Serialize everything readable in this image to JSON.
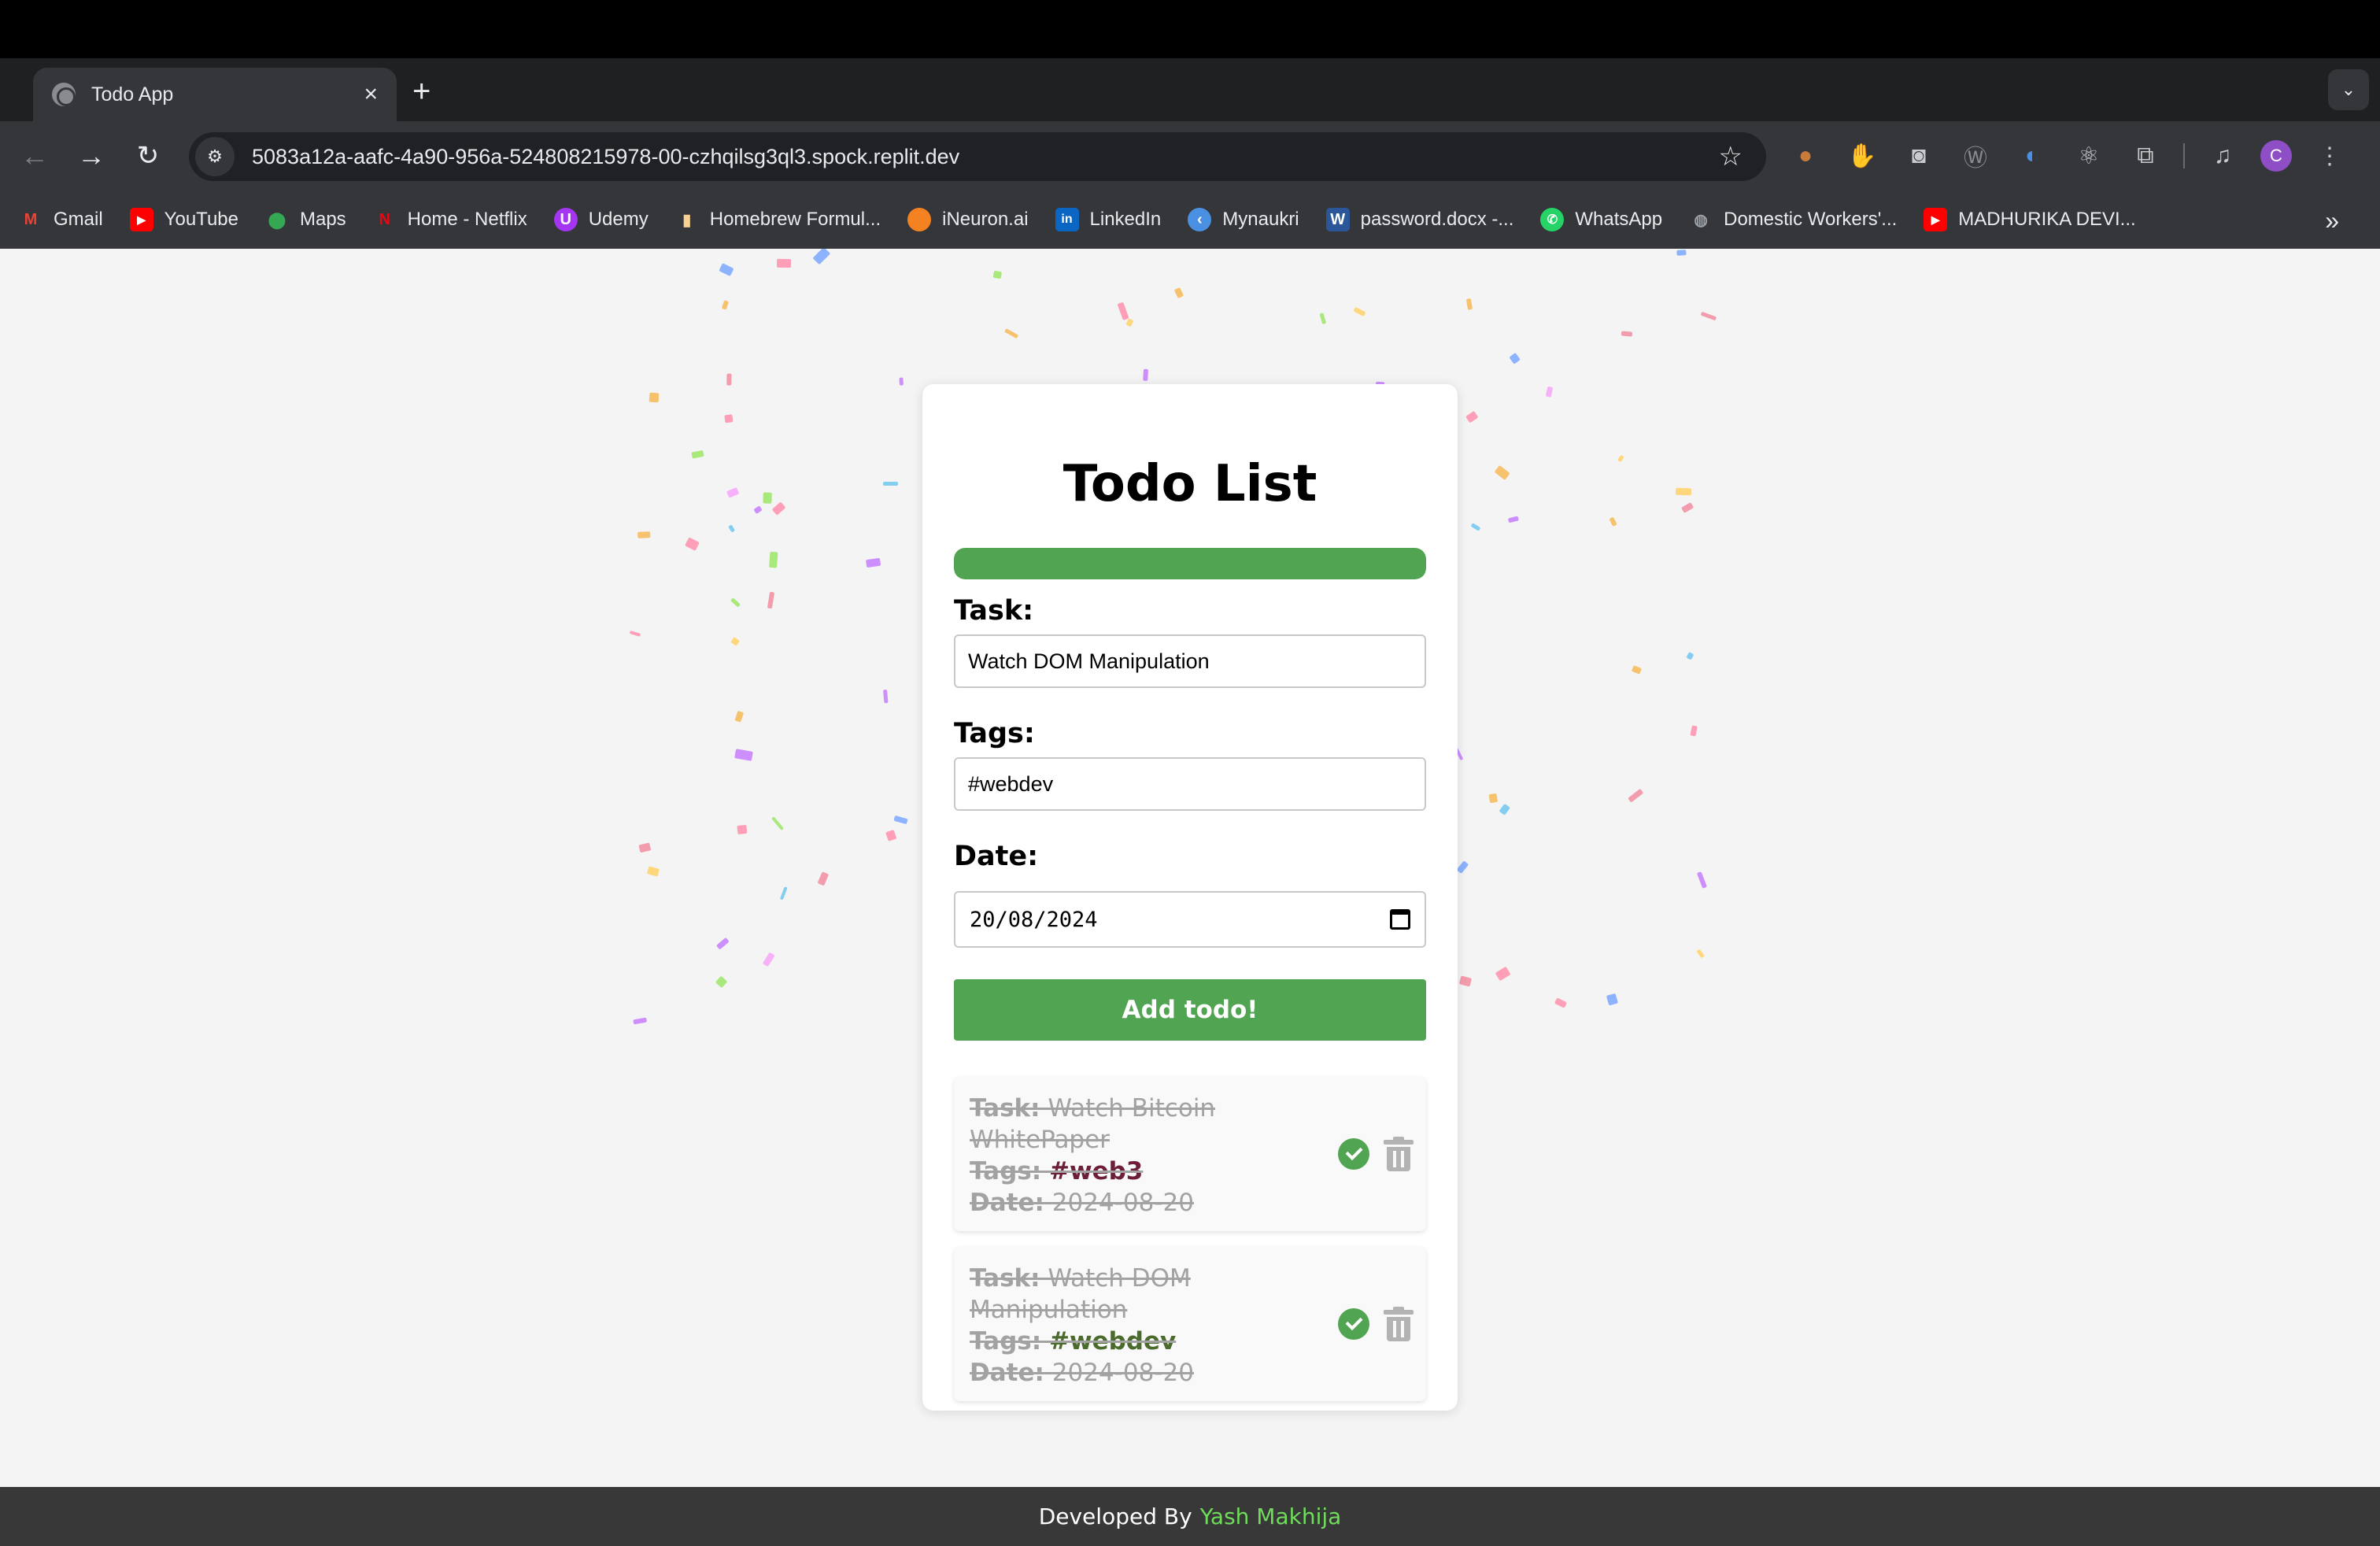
{
  "browser": {
    "tab_title": "Todo App",
    "tab_close": "×",
    "new_tab": "+",
    "url": "5083a12a-aafc-4a90-956a-524808215978-00-czhqilsg3ql3.spock.replit.dev",
    "bookmarks": [
      {
        "label": "Gmail",
        "icon": "gmail-icon",
        "color": "#ea4335"
      },
      {
        "label": "YouTube",
        "icon": "youtube-icon",
        "color": "#ff0000"
      },
      {
        "label": "Maps",
        "icon": "maps-icon",
        "color": "#34a853"
      },
      {
        "label": "Home - Netflix",
        "icon": "netflix-icon",
        "color": "#e50914"
      },
      {
        "label": "Udemy",
        "icon": "udemy-icon",
        "color": "#a435f0"
      },
      {
        "label": "Homebrew Formul...",
        "icon": "homebrew-icon",
        "color": "#f9d094"
      },
      {
        "label": "iNeuron.ai",
        "icon": "ineuron-icon",
        "color": "#f58220"
      },
      {
        "label": "LinkedIn",
        "icon": "linkedin-icon",
        "color": "#0a66c2"
      },
      {
        "label": "Mynaukri",
        "icon": "naukri-icon",
        "color": "#4a90e2"
      },
      {
        "label": "password.docx -...",
        "icon": "word-icon",
        "color": "#2b579a"
      },
      {
        "label": "WhatsApp",
        "icon": "whatsapp-icon",
        "color": "#25d366"
      },
      {
        "label": "Domestic Workers'...",
        "icon": "globe-icon",
        "color": "#9aa0a6"
      },
      {
        "label": "MADHURIKA DEVI...",
        "icon": "youtube-icon",
        "color": "#ff0000"
      }
    ],
    "avatar_letter": "C"
  },
  "app": {
    "title": "Todo List",
    "progress": 1.0,
    "task_label": "Task:",
    "task_value": "Watch DOM Manipulation",
    "tags_label": "Tags:",
    "tags_value": "#webdev",
    "date_label": "Date:",
    "date_value": "20/08/2024",
    "add_button": "Add todo!",
    "todos": [
      {
        "task_label": "Task:",
        "task": "Watch Bitcoin WhitePaper",
        "tags_label": "Tags:",
        "tags": "#web3",
        "tag_color": "#6d1f37",
        "date_label": "Date:",
        "date": "2024-08-20",
        "done": true
      },
      {
        "task_label": "Task:",
        "task": "Watch DOM Manipulation",
        "tags_label": "Tags:",
        "tags": "#webdev",
        "tag_color": "#4b6b2d",
        "date_label": "Date:",
        "date": "2024-08-20",
        "done": true
      }
    ]
  },
  "footer": {
    "prefix": "Developed By",
    "author": "Yash Makhija",
    "author_color": "#6fdc5a"
  },
  "colors": {
    "accent_green": "#51a451",
    "completed_text": "#a2a2a2"
  }
}
